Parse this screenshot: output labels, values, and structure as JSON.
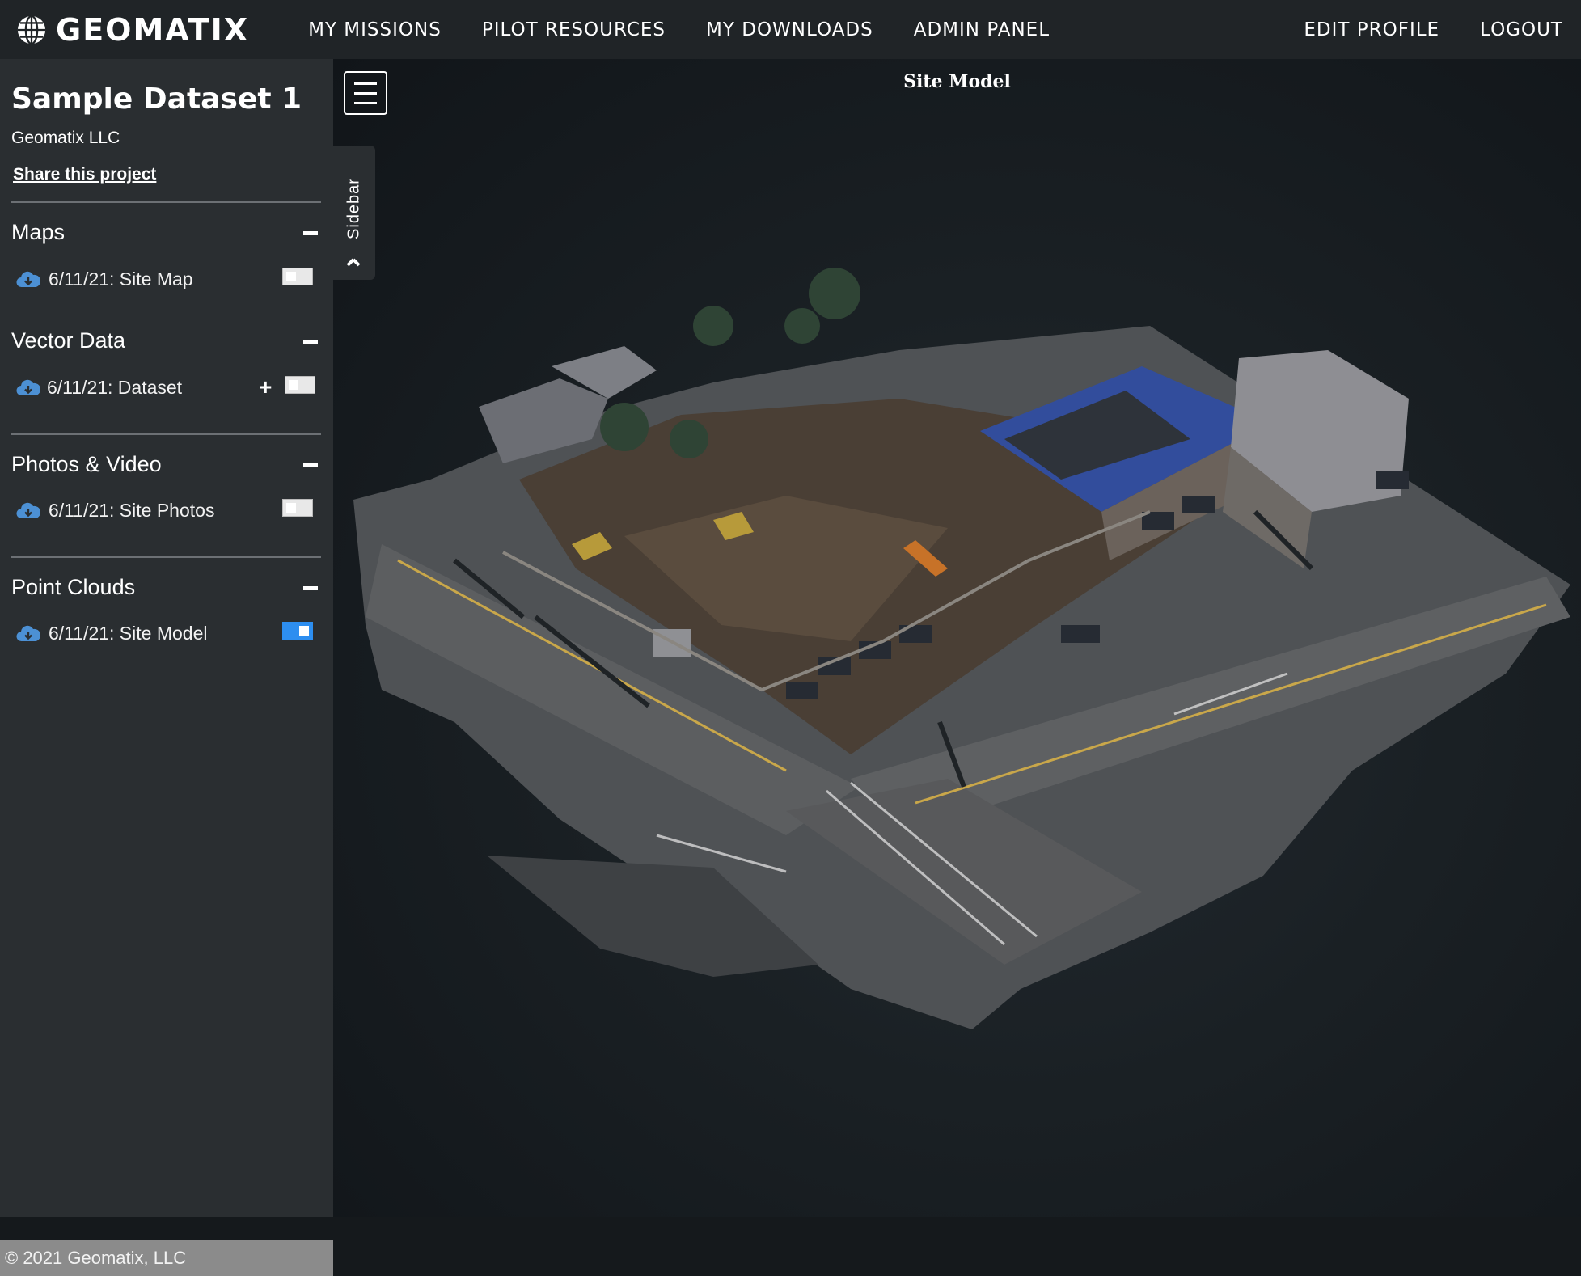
{
  "brand": {
    "name": "GEOMATIX",
    "icon": "globe-icon"
  },
  "nav": {
    "left": [
      "MY MISSIONS",
      "PILOT RESOURCES",
      "MY DOWNLOADS",
      "ADMIN PANEL"
    ],
    "right": [
      "EDIT PROFILE",
      "LOGOUT"
    ]
  },
  "project": {
    "title": "Sample Dataset 1",
    "organization": "Geomatix LLC",
    "share_label": "Share this project"
  },
  "sections": [
    {
      "title": "Maps",
      "items": [
        {
          "label": "6/11/21: Site Map",
          "enabled": false
        }
      ]
    },
    {
      "title": "Vector Data",
      "items": [
        {
          "label": "6/11/21: Dataset",
          "enabled": false,
          "add_icon": "plus-icon"
        }
      ]
    },
    {
      "title": "Photos & Video",
      "items": [
        {
          "label": "6/11/21: Site Photos",
          "enabled": false
        }
      ]
    },
    {
      "title": "Point Clouds",
      "items": [
        {
          "label": "6/11/21: Site Model",
          "enabled": true
        }
      ]
    }
  ],
  "viewer": {
    "title": "Site Model",
    "sidebar_tab_label": "Sidebar",
    "menu_icon": "hamburger-menu-icon",
    "collapse_icon": "chevron-left-icon"
  },
  "footer": {
    "copyright": "© 2021 Geomatix, LLC"
  },
  "colors": {
    "nav_bg": "#202427",
    "sidebar_bg": "#2a2e31",
    "toggle_on": "#2d8ef0",
    "footer_bg": "#8b8b8b",
    "viewer_bg": "#15191c"
  }
}
